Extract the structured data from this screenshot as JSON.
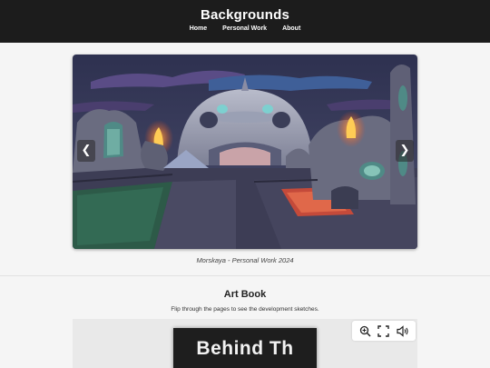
{
  "header": {
    "title": "Backgrounds",
    "nav": [
      "Home",
      "Personal Work",
      "About"
    ]
  },
  "carousel": {
    "prev_glyph": "❮",
    "next_glyph": "❯",
    "caption": "Morskaya - Personal Work 2024"
  },
  "art_book": {
    "title": "Art Book",
    "subtitle": "Flip through the pages to see the development sketches.",
    "cover_text": "Behind Th",
    "tools": [
      "zoom-in-icon",
      "fullscreen-icon",
      "sound-icon"
    ]
  },
  "colors": {
    "header_bg": "#1c1c1c",
    "page_bg": "#f5f5f5",
    "book_bg": "#1e1e1e"
  }
}
